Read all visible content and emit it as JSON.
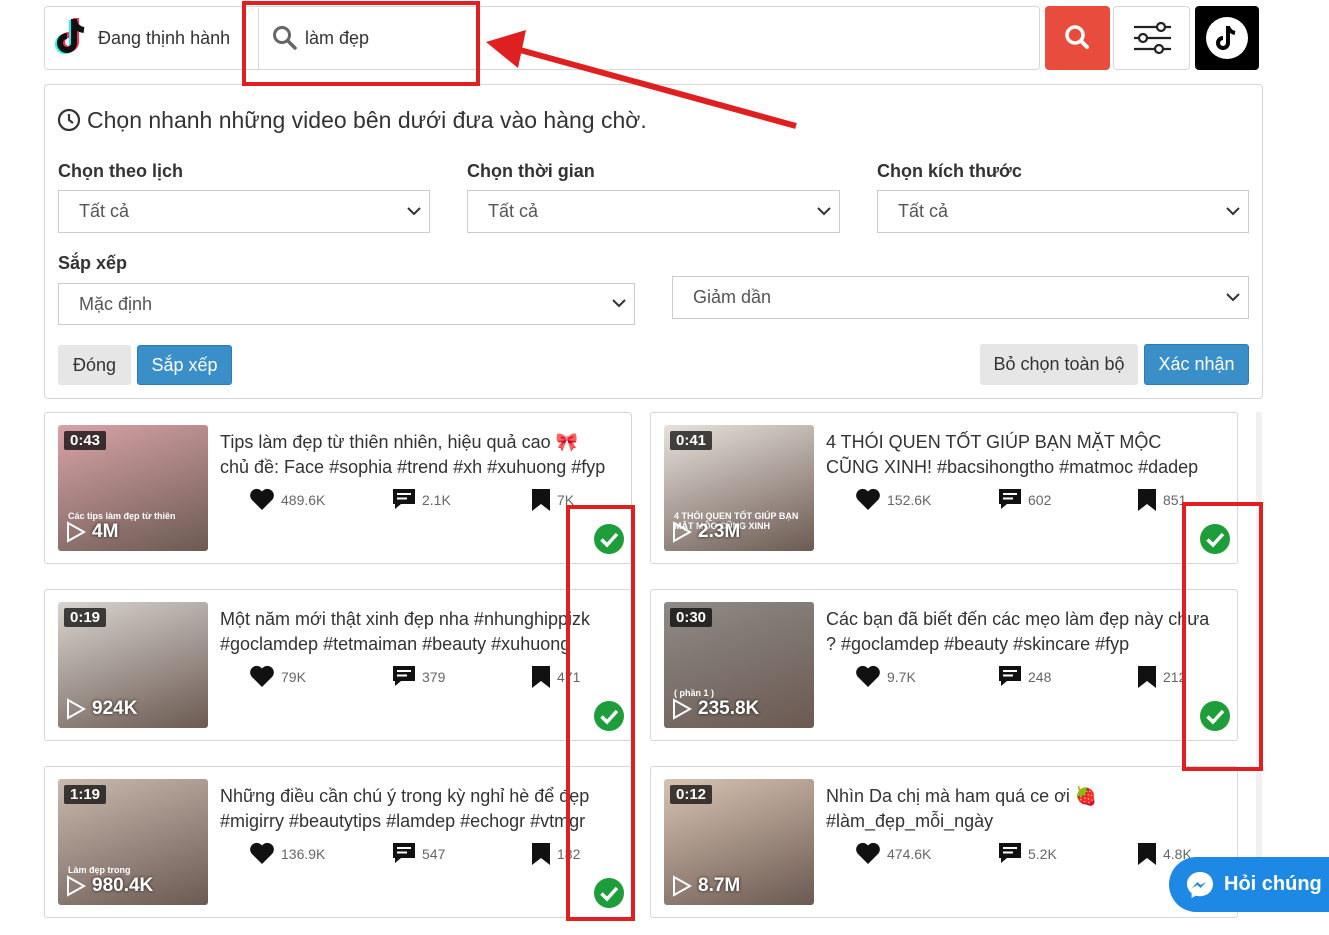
{
  "header": {
    "trend_label": "Đang thịnh hành",
    "search_value": "làm đẹp",
    "icons": [
      "tiktok-logo-icon",
      "search-icon",
      "sliders-icon",
      "tiktok-icon"
    ]
  },
  "filter_panel": {
    "title": "Chọn nhanh những video bên dưới đưa vào hàng chờ.",
    "calendar_label": "Chọn theo lịch",
    "calendar_value": "Tất cả",
    "time_label": "Chọn thời gian",
    "time_value": "Tất cả",
    "size_label": "Chọn kích thước",
    "size_value": "Tất cả",
    "sort_label": "Sắp xếp",
    "sort_value": "Mặc định",
    "order_value": "Giảm dần",
    "close_label": "Đóng",
    "sort_button_label": "Sắp xếp",
    "deselect_label": "Bỏ chọn toàn bộ",
    "confirm_label": "Xác nhận"
  },
  "videos": [
    {
      "duration": "0:43",
      "views": "4M",
      "title": "Tips làm đẹp từ thiên nhiên, hiệu quả cao 🎀 chủ đề: Face #sophia #trend #xh #xuhuong #fyp ...",
      "likes": "489.6K",
      "comments": "2.1K",
      "saves": "7K",
      "thumb_caption": "Các tips làm đẹp từ thiên",
      "thumb_color": "#d9a3a8"
    },
    {
      "duration": "0:41",
      "views": "2.3M",
      "title": "4 THÓI QUEN TỐT GIÚP BẠN MẶT MỘC CŨNG XINH! #bacsihongtho #matmoc #dadep duongda...",
      "likes": "152.6K",
      "comments": "602",
      "saves": "851",
      "thumb_caption": "4 THÓI QUEN TỐT GIÚP BẠN MẶT MỘC CŨNG XINH",
      "thumb_color": "#e8e2dc"
    },
    {
      "duration": "0:19",
      "views": "924K",
      "title": "Một năm mới thật xinh đẹp nha #nhunghippizk #goclamdep #tetmaiman #beauty #xuhuong #tip...",
      "likes": "79K",
      "comments": "379",
      "saves": "471",
      "thumb_caption": "",
      "thumb_color": "#d8d4cf"
    },
    {
      "duration": "0:30",
      "views": "235.8K",
      "title": "Các bạn đã biết đến các mẹo làm đẹp này chưa ? #goclamdep #beauty #skincare #fyp #learnontikt...",
      "likes": "9.7K",
      "comments": "248",
      "saves": "212",
      "thumb_caption": "( phần 1 )",
      "thumb_color": "#8f8a86"
    },
    {
      "duration": "1:19",
      "views": "980.4K",
      "title": "Những điều cần chú ý trong kỳ nghỉ hè để đẹp #migirry #beautytips #lamdep #echogr #vtmgr #fyp",
      "likes": "136.9K",
      "comments": "547",
      "saves": "182",
      "thumb_caption": "Làm đẹp trong",
      "thumb_color": "#c9b9ae"
    },
    {
      "duration": "0:12",
      "views": "8.7M",
      "title": "Nhìn Da chị mà ham quá ce ơi 🍓 #làm_đẹp_mỗi_ngày",
      "likes": "474.6K",
      "comments": "5.2K",
      "saves": "4.8K",
      "thumb_caption": "",
      "thumb_color": "#d7c3b2"
    }
  ],
  "chat_widget": {
    "label": "Hỏi chúng"
  },
  "colors": {
    "accent_red": "#e74c3c",
    "button_blue": "#3a8fc8",
    "check_green": "#1e9e3a",
    "annotation_red": "#e02020",
    "messenger_blue": "#1e88e5"
  }
}
